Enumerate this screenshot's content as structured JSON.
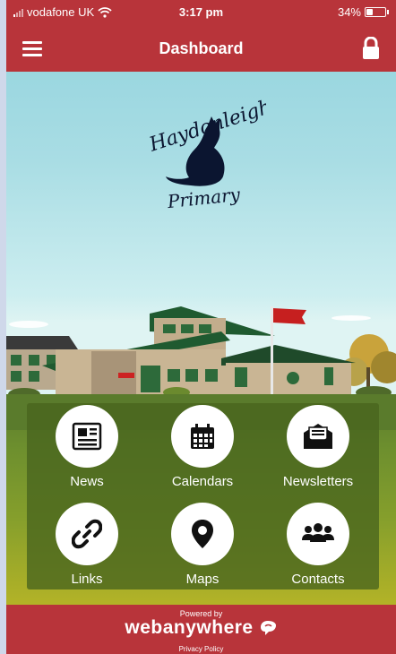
{
  "status_bar": {
    "carrier": "vodafone UK",
    "time": "3:17 pm",
    "battery_text": "34%",
    "battery_level": 0.34
  },
  "header": {
    "title": "Dashboard",
    "menu_icon": "hamburger-menu-icon",
    "lock_icon": "padlock-icon"
  },
  "logo": {
    "line1": "Haydonleigh",
    "line2": "Primary"
  },
  "tiles": [
    {
      "label": "News",
      "icon": "newspaper-icon"
    },
    {
      "label": "Calendars",
      "icon": "calendar-icon"
    },
    {
      "label": "Newsletters",
      "icon": "envelope-icon"
    },
    {
      "label": "Links",
      "icon": "link-icon"
    },
    {
      "label": "Maps",
      "icon": "map-pin-icon"
    },
    {
      "label": "Contacts",
      "icon": "people-icon"
    }
  ],
  "footer": {
    "powered_by": "Powered by",
    "brand": "webanywhere",
    "privacy": "Privacy Policy"
  },
  "colors": {
    "brand_red": "#b8343a",
    "tile_icon": "#111111"
  }
}
